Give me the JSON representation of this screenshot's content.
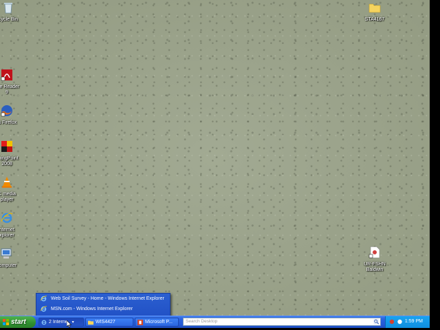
{
  "desktop": {
    "icons": [
      {
        "id": "recycle",
        "label": "cycle Bin",
        "icon": "recycle-bin-icon"
      },
      {
        "id": "adobe",
        "label": "obe Reader\n9",
        "icon": "adobe-reader-icon"
      },
      {
        "id": "firefox",
        "label": "la Firefox",
        "icon": "firefox-icon"
      },
      {
        "id": "farmingpoint",
        "label": "rmingPoint\n2008",
        "icon": "farmingpoint-icon"
      },
      {
        "id": "vlc",
        "label": "C media\nplayer",
        "icon": "vlc-icon"
      },
      {
        "id": "ie",
        "label": "nternet\nxplorer",
        "icon": "internet-explorer-icon"
      },
      {
        "id": "computer",
        "label": "Computer",
        "icon": "my-computer-icon"
      },
      {
        "id": "sta4167",
        "label": "STA4167",
        "icon": "folder-icon"
      },
      {
        "id": "urfshn",
        "label": "UR-FSHN\nBaldwin",
        "icon": "document-icon"
      }
    ]
  },
  "popup": {
    "items": [
      {
        "label": "Web Soil Survey - Home - Windows Internet Explorer",
        "icon": "internet-explorer-icon"
      },
      {
        "label": "MSN.com - Windows Internet Explorer",
        "icon": "internet-explorer-icon"
      }
    ]
  },
  "taskbar": {
    "start_label": "start",
    "tasks": [
      {
        "label": "2 Interne",
        "icon": "internet-explorer-icon",
        "active": true
      },
      {
        "label": "WIS4427",
        "icon": "folder-icon",
        "active": false
      },
      {
        "label": "Microsoft P...",
        "icon": "powerpoint-icon",
        "active": false
      }
    ],
    "search_placeholder": "Search Desktop",
    "clock": "1:59 PM"
  },
  "colors": {
    "taskbar_blue": "#245ad6",
    "start_green": "#2f8f2f",
    "tray_blue": "#0f8ee0",
    "desktop_bg": "#9aa28a"
  }
}
